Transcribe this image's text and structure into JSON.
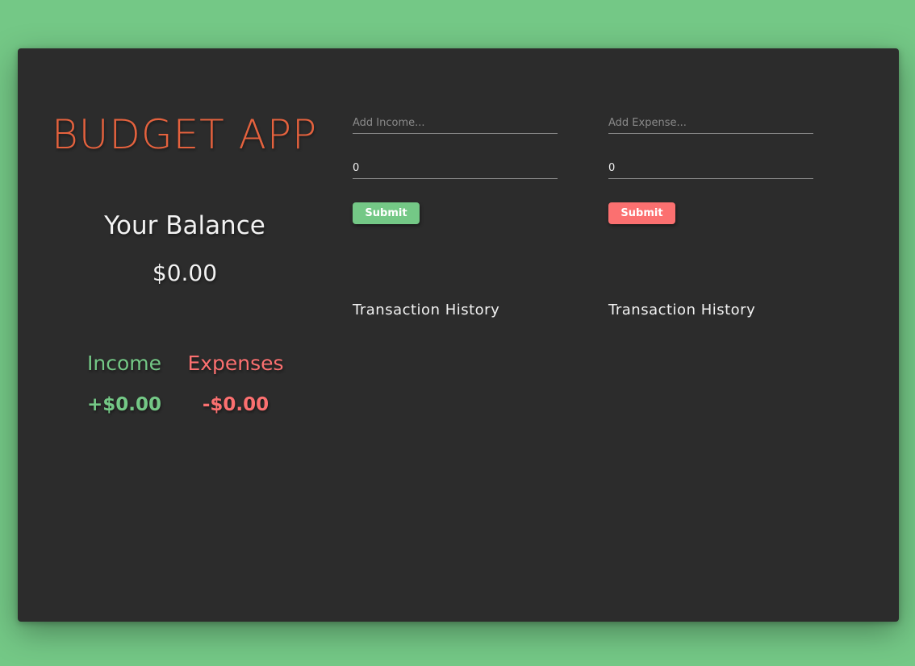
{
  "app": {
    "title": "BUDGET APP"
  },
  "balance": {
    "label": "Your Balance",
    "value": "$0.00"
  },
  "summary": {
    "income_label": "Income",
    "income_value": "+$0.00",
    "expense_label": "Expenses",
    "expense_value": "-$0.00"
  },
  "income_form": {
    "name_placeholder": "Add Income...",
    "amount_value": "0",
    "submit_label": "Submit",
    "history_title": "Transaction History"
  },
  "expense_form": {
    "name_placeholder": "Add Expense...",
    "amount_value": "0",
    "submit_label": "Submit",
    "history_title": "Transaction History"
  },
  "colors": {
    "background": "#74c886",
    "card": "#2c2c2c",
    "title": "#e5623e",
    "income": "#74c886",
    "expense": "#fb7070"
  }
}
